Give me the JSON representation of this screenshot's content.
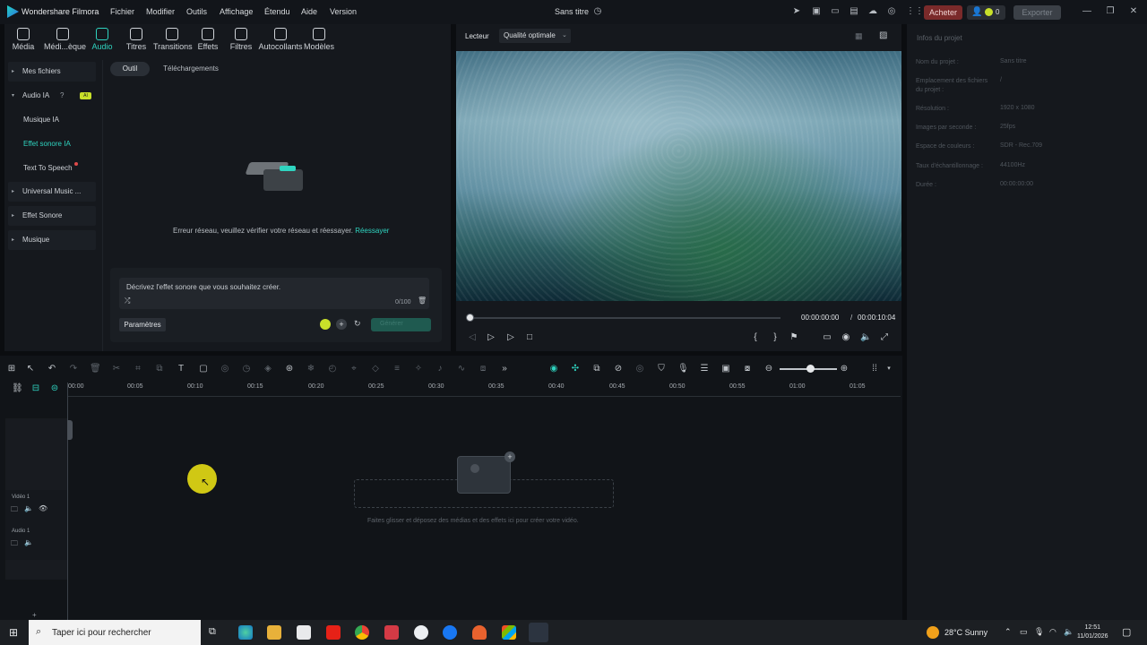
{
  "titlebar": {
    "app_name": "Wondershare Filmora",
    "menus": [
      "Fichier",
      "Modifier",
      "Outils",
      "Affichage",
      "Étendu",
      "Aide",
      "Version"
    ],
    "project_title": "Sans titre",
    "buy_label": "Acheter",
    "credits": "0",
    "export_label": "Exporter"
  },
  "library": {
    "categories": [
      {
        "label": "Média",
        "icon": "media-icon"
      },
      {
        "label": "Médi...èque",
        "icon": "library-icon"
      },
      {
        "label": "Audio",
        "icon": "audio-icon"
      },
      {
        "label": "Titres",
        "icon": "titles-icon"
      },
      {
        "label": "Transitions",
        "icon": "transitions-icon"
      },
      {
        "label": "Effets",
        "icon": "effects-icon"
      },
      {
        "label": "Filtres",
        "icon": "filters-icon"
      },
      {
        "label": "Autocollants",
        "icon": "stickers-icon"
      },
      {
        "label": "Modèles",
        "icon": "templates-icon"
      }
    ],
    "sidebar": {
      "my_files": "Mes fichiers",
      "ai_audio": "Audio IA",
      "ai_badge": "AI",
      "ai_music": "Musique IA",
      "ai_sound_effect": "Effet sonore IA",
      "tts": "Text To Speech",
      "universal_music": "Universal Music ...",
      "sound_effect": "Effet Sonore",
      "music": "Musique"
    },
    "tabs": [
      "Outil",
      "Téléchargements"
    ],
    "error_text": "Erreur réseau, veuillez vérifier votre réseau et réessayer. ",
    "retry_label": "Réessayer",
    "prompt": {
      "placeholder": "Décrivez l'effet sonore que vous souhaitez créer.",
      "counter": "0/100",
      "params_label": "Paramètres",
      "generate_label": "Générer"
    }
  },
  "player": {
    "tab_label": "Lecteur",
    "quality": "Qualité optimale",
    "time_current": "00:00:00:00",
    "time_separator": "/",
    "time_total": "00:00:10:04",
    "progress": 0
  },
  "properties": {
    "title": "Infos du projet",
    "rows": [
      {
        "label": "Nom du projet :",
        "value": "Sans titre"
      },
      {
        "label": "Emplacement des fichiers du projet :",
        "value": "/"
      },
      {
        "label": "Résolution :",
        "value": "1920 x 1080"
      },
      {
        "label": "Images par seconde :",
        "value": "25fps"
      },
      {
        "label": "Espace de couleurs :",
        "value": "SDR - Rec.709"
      },
      {
        "label": "Taux d'échantillonnage :",
        "value": "44100Hz"
      },
      {
        "label": "Durée :",
        "value": "00:00:00:00"
      }
    ]
  },
  "timeline": {
    "ruler": [
      "00:00",
      "00:05",
      "00:10",
      "00:15",
      "00:20",
      "00:25",
      "00:30",
      "00:35",
      "00:40",
      "00:45",
      "00:50",
      "00:55",
      "01:00",
      "01:05"
    ],
    "tracks": [
      {
        "name": "Vidéo 1"
      },
      {
        "name": "Audio 1"
      }
    ],
    "drop_hint": "Faites glisser et déposez des médias et des effets ici pour créer votre vidéo."
  },
  "taskbar": {
    "search_placeholder": "Taper ici pour rechercher",
    "weather": "28°C  Sunny",
    "time": "12:51",
    "date": "11/01/2026"
  },
  "colors": {
    "accent": "#2fd4c0",
    "buy": "#7a2a2a",
    "cursor_highlight": "#e6dc14"
  }
}
